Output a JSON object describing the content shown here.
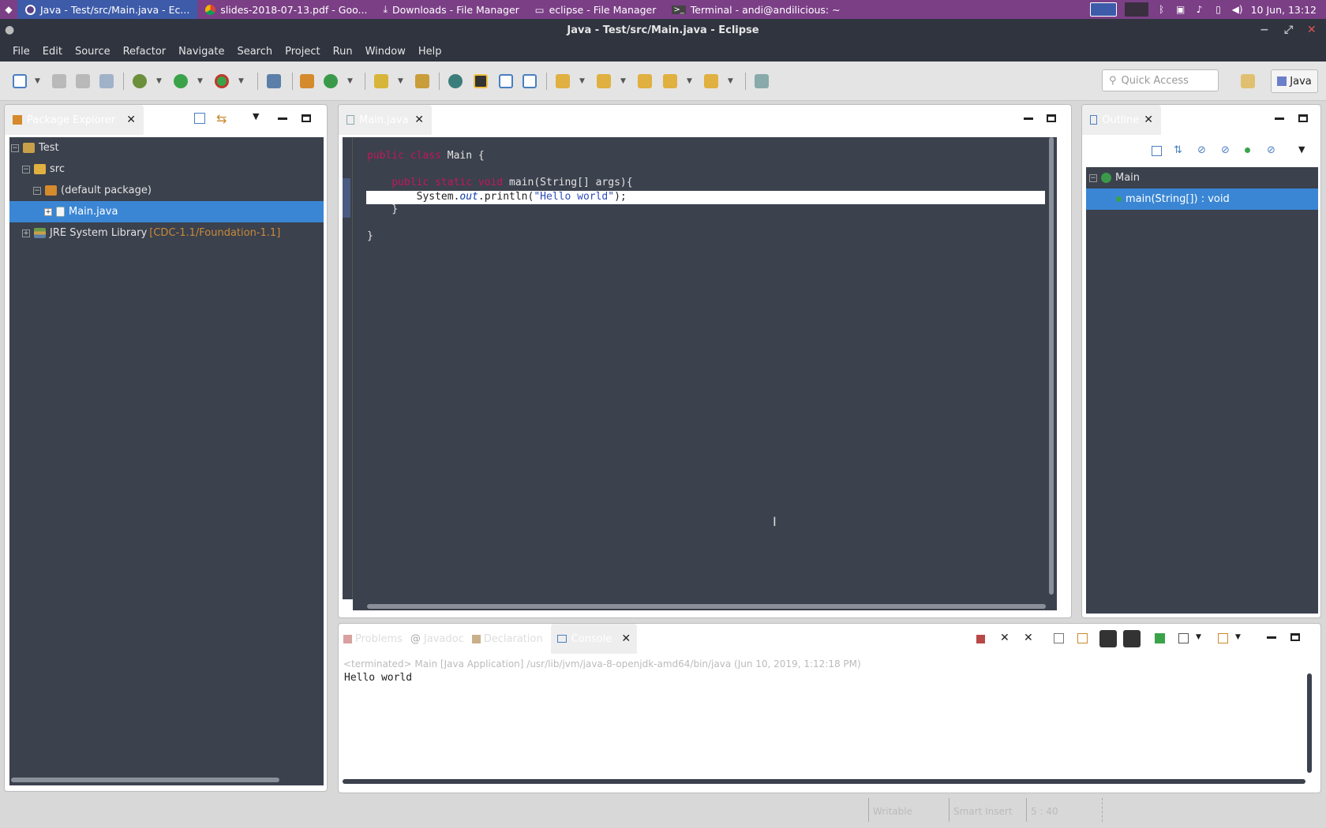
{
  "taskbar": {
    "tabs": [
      {
        "label": "Java - Test/src/Main.java - Ec...",
        "active": true,
        "icon": "eclipse-icon"
      },
      {
        "label": "slides-2018-07-13.pdf - Goo...",
        "active": false,
        "icon": "chrome-icon"
      },
      {
        "label": "Downloads - File Manager",
        "active": false,
        "icon": "download-icon"
      },
      {
        "label": "eclipse - File Manager",
        "active": false,
        "icon": "folder-icon"
      },
      {
        "label": "Terminal - andi@andilicious: ~",
        "active": false,
        "icon": "terminal-icon"
      }
    ],
    "clock": "10 Jun, 13:12"
  },
  "window": {
    "title": "Java - Test/src/Main.java - Eclipse"
  },
  "menu": [
    "File",
    "Edit",
    "Source",
    "Refactor",
    "Navigate",
    "Search",
    "Project",
    "Run",
    "Window",
    "Help"
  ],
  "toolbar": {
    "quick_access_placeholder": "Quick Access",
    "perspective": "Java"
  },
  "package_explorer": {
    "title": "Package Explorer",
    "tree": [
      {
        "label": "Test",
        "level": 0,
        "toggle": "−",
        "icon": "project-icon"
      },
      {
        "label": "src",
        "level": 1,
        "toggle": "−",
        "icon": "source-folder-icon"
      },
      {
        "label": "(default package)",
        "level": 2,
        "toggle": "−",
        "icon": "package-icon"
      },
      {
        "label": "Main.java",
        "level": 3,
        "toggle": "+",
        "icon": "java-file-icon",
        "selected": true
      },
      {
        "label": "JRE System Library",
        "suffix": "[CDC-1.1/Foundation-1.1]",
        "level": 1,
        "toggle": "+",
        "icon": "library-icon"
      }
    ]
  },
  "editor": {
    "tab": "Main.java",
    "lines": [
      "public class Main {",
      "",
      "    public static void main(String[] args){",
      "        System.out.println(\"Hello world\");",
      "    }",
      "",
      "}"
    ]
  },
  "outline": {
    "title": "Outline",
    "class_name": "Main",
    "method": "main(String[]) : void"
  },
  "bottom_tabs": {
    "problems": "Problems",
    "javadoc": "Javadoc",
    "declaration": "Declaration",
    "console": "Console"
  },
  "console": {
    "header": "<terminated> Main [Java Application] /usr/lib/jvm/java-8-openjdk-amd64/bin/java (Jun 10, 2019, 1:12:18 PM)",
    "output": "Hello world"
  },
  "status": {
    "writable": "Writable",
    "insert": "Smart Insert",
    "position": "5 : 40"
  }
}
